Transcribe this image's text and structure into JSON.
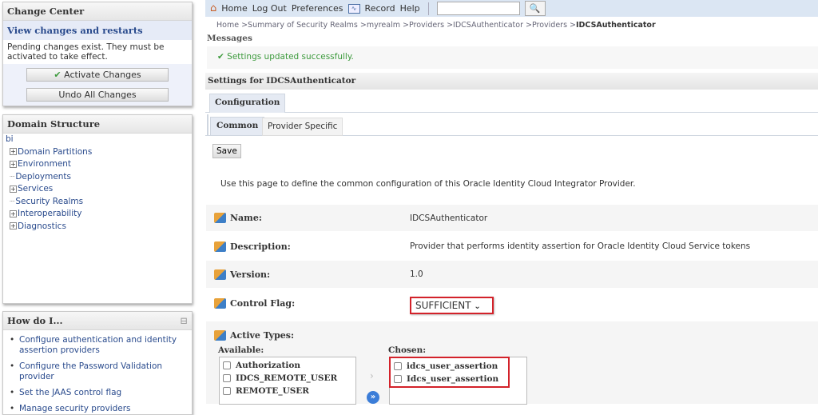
{
  "change_center": {
    "title": "Change Center",
    "view_link": "View changes and restarts",
    "pending_text": "Pending changes exist. They must be activated to take effect.",
    "activate_label": "Activate Changes",
    "undo_label": "Undo All Changes"
  },
  "domain_structure": {
    "title": "Domain Structure",
    "root": "bi",
    "items": [
      {
        "label": "Domain Partitions",
        "expandable": true
      },
      {
        "label": "Environment",
        "expandable": true
      },
      {
        "label": "Deployments",
        "expandable": false
      },
      {
        "label": "Services",
        "expandable": true
      },
      {
        "label": "Security Realms",
        "expandable": false
      },
      {
        "label": "Interoperability",
        "expandable": true
      },
      {
        "label": "Diagnostics",
        "expandable": true
      }
    ]
  },
  "how_do_i": {
    "title": "How do I...",
    "items": [
      "Configure authentication and identity assertion providers",
      "Configure the Password Validation provider",
      "Set the JAAS control flag",
      "Manage security providers"
    ]
  },
  "toolbar": {
    "home": "Home",
    "logout": "Log Out",
    "preferences": "Preferences",
    "record": "Record",
    "help": "Help",
    "search_value": ""
  },
  "breadcrumb": {
    "items": [
      "Home >",
      "Summary of Security Realms >",
      "myrealm >",
      "Providers >",
      "IDCSAuthenticator >",
      "Providers >"
    ],
    "current": "IDCSAuthenticator"
  },
  "messages": {
    "title": "Messages",
    "success": "Settings updated successfully."
  },
  "settings": {
    "title": "Settings for IDCSAuthenticator",
    "tab_configuration": "Configuration",
    "subtab_common": "Common",
    "subtab_provider": "Provider Specific",
    "save_label": "Save",
    "intro": "Use this page to define the common configuration of this Oracle Identity Cloud Integrator Provider.",
    "fields": {
      "name_label": "Name:",
      "name_value": "IDCSAuthenticator",
      "description_label": "Description:",
      "description_value": "Provider that performs identity assertion for Oracle Identity Cloud Service tokens",
      "version_label": "Version:",
      "version_value": "1.0",
      "control_flag_label": "Control Flag:",
      "control_flag_value": "SUFFICIENT",
      "active_types_label": "Active Types:"
    },
    "available_label": "Available:",
    "available": [
      "Authorization",
      "IDCS_REMOTE_USER",
      "REMOTE_USER"
    ],
    "chosen_label": "Chosen:",
    "chosen": [
      "idcs_user_assertion",
      "Idcs_user_assertion"
    ]
  },
  "colors": {
    "highlight": "#d3222a",
    "link": "#2a4b8d",
    "success": "#3c9a3c"
  }
}
